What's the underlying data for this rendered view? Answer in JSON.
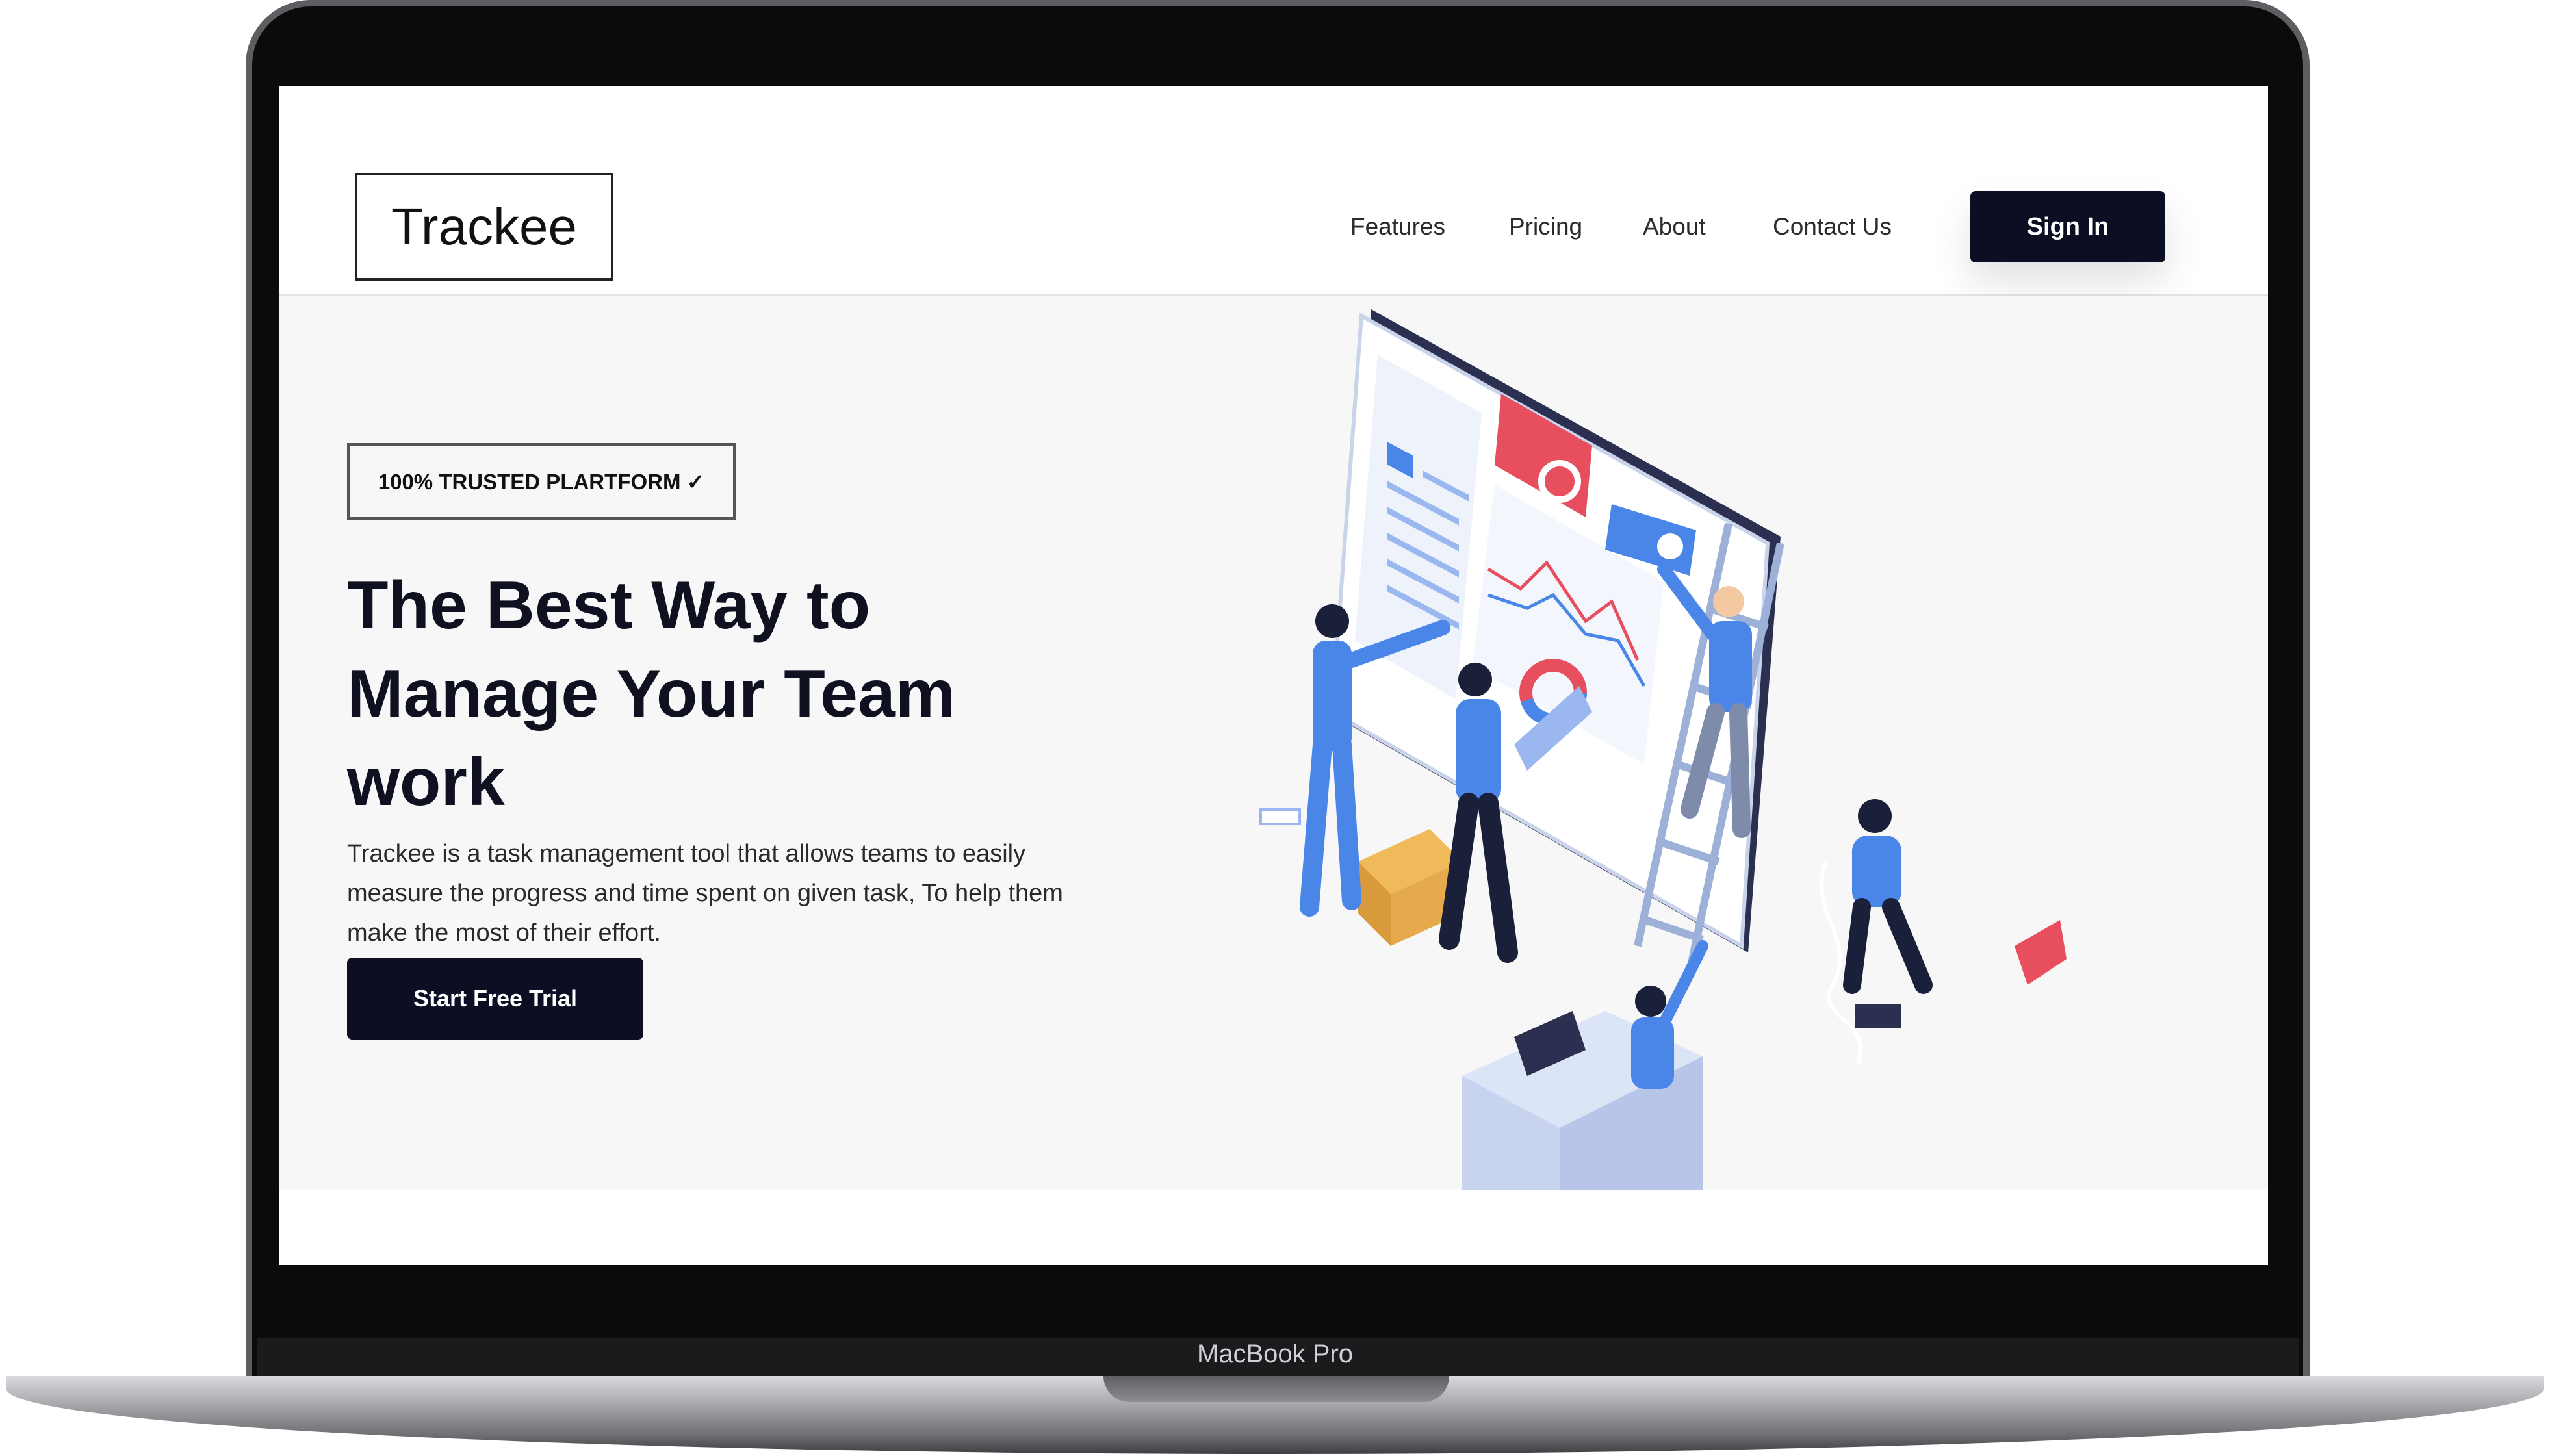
{
  "device": {
    "label": "MacBook Pro"
  },
  "site": {
    "brand": "Trackee",
    "nav": [
      {
        "label": "Features"
      },
      {
        "label": "Pricing"
      },
      {
        "label": "About"
      },
      {
        "label": "Contact Us"
      }
    ],
    "signin_label": "Sign In"
  },
  "hero": {
    "badge": "100% TRUSTED PLARTFORM ✓",
    "headline_lines": [
      "The Best Way to",
      "Manage Your Team",
      "work"
    ],
    "description": "Trackee is a task management tool that allows teams to easily measure the progress and time spent on given task, To help them make the most of their effort.",
    "cta_label": "Start Free Trial",
    "illustration_icon": "team-dashboard-illustration"
  },
  "colors": {
    "brand_dark": "#0c0f24",
    "accent_blue": "#4a86e8",
    "accent_red": "#e84f5e",
    "hero_bg": "#f7f7f8"
  }
}
